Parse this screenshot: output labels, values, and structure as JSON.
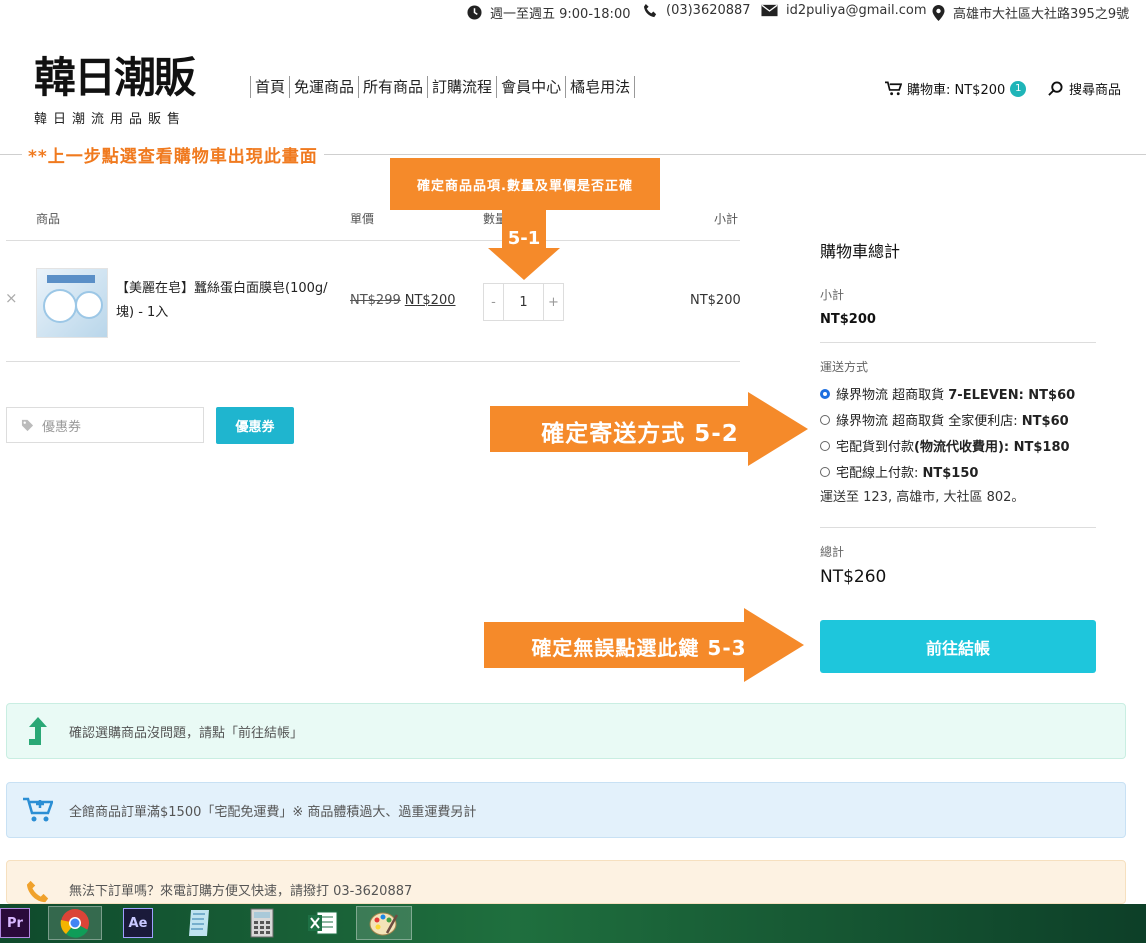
{
  "topbar": {
    "hours": "週一至週五 9:00-18:00",
    "phone": "(03)3620887",
    "email": "id2puliya@gmail.com",
    "address": "高雄市大社區大社路395之9號"
  },
  "logo": {
    "title": "韓日潮販",
    "subtitle": "韓日潮流用品販售"
  },
  "nav": [
    "首頁",
    "免運商品",
    "所有商品",
    "訂購流程",
    "會員中心",
    "橘皂用法"
  ],
  "header": {
    "cart_label": "購物車: NT$200",
    "cart_count": "1",
    "search_label": "搜尋商品"
  },
  "annotation": {
    "note": "**上一步點選查看購物車出現此畫面",
    "check_items": "確定商品品項.數量及單價是否正確",
    "step1": "5-1",
    "shipping": "確定寄送方式 5-2",
    "confirm": "確定無誤點選此鍵 5-3"
  },
  "table": {
    "headers": {
      "product": "商品",
      "price": "單價",
      "qty": "數量",
      "subtotal": "小計"
    },
    "rows": [
      {
        "remove": "×",
        "name": "【美麗在皂】蠶絲蛋白面膜皂(100g/塊) - 1入",
        "old_price": "NT$299",
        "new_price": "NT$200",
        "qty": "1",
        "minus": "-",
        "plus": "+",
        "subtotal": "NT$200"
      }
    ]
  },
  "coupon": {
    "placeholder": "優惠券",
    "button": "優惠券"
  },
  "cart_totals": {
    "title": "購物車總計",
    "subtotal_label": "小計",
    "subtotal": "NT$200",
    "shipping_label": "運送方式",
    "options": [
      {
        "text": "綠界物流 超商取貨 ",
        "price": "7-ELEVEN: NT$60",
        "selected": true
      },
      {
        "text": "綠界物流 超商取貨 全家便利店: ",
        "price": "NT$60",
        "selected": false
      },
      {
        "text": "宅配貨到付款",
        "price": "(物流代收費用): NT$180",
        "selected": false
      },
      {
        "text": "宅配線上付款: ",
        "price": "NT$150",
        "selected": false
      }
    ],
    "ship_to": "運送至 123, 高雄市, 大社區 802。",
    "total_label": "總計",
    "total": "NT$260",
    "checkout_button": "前往結帳"
  },
  "notices": [
    "確認選購商品沒問題，請點「前往結帳」",
    "全館商品訂單滿$1500「宅配免運費」※ 商品體積過大、過重運費另計",
    "無法下訂單嗎？來電訂購方便又快速，請撥打 03-3620887"
  ],
  "taskbar": {
    "apps": [
      "Pr",
      "chrome-icon",
      "Ae",
      "notepad-icon",
      "calculator-icon",
      "excel-icon",
      "paint-icon"
    ],
    "pr_label": "Pr",
    "ae_label": "Ae"
  }
}
